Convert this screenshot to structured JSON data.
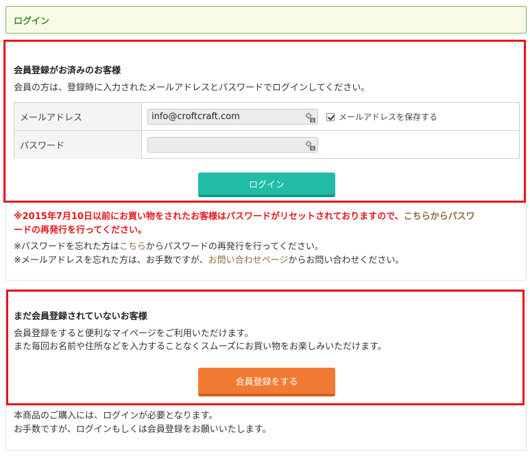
{
  "header": {
    "title": "ログイン"
  },
  "member_section": {
    "title": "会員登録がお済みのお客様",
    "description": "会員の方は、登録時に入力されたメールアドレスとパスワードでログインしてください。",
    "email_label": "メールアドレス",
    "email_value": "info@croftcraft.com",
    "remember_label": "メールアドレスを保存する",
    "password_label": "パスワード",
    "password_value": "",
    "login_button": "ログイン"
  },
  "notice": {
    "warning_pre": "※2015年7月10日以前にお買い物をされたお客様はパスワードがリセットされておりますので、",
    "warning_link": "こちらからパスワ",
    "warning_post": "ードの再発行を行ってください。",
    "forgot_pw_pre": "※パスワードを忘れた方は",
    "forgot_pw_link": "こちら",
    "forgot_pw_post": "からパスワードの再発行を行ってください。",
    "forgot_mail_pre": "※メールアドレスを忘れた方は、お手数ですが、",
    "forgot_mail_link": "お問い合わせページ",
    "forgot_mail_post": "からお問い合わせください。"
  },
  "guest_section": {
    "title": "まだ会員登録されていないお客様",
    "line1": "会員登録をすると便利なマイページをご利用いただけます。",
    "line2": "また毎回お名前や住所などを入力することなくスムーズにお買い物をお楽しみいただけます。",
    "register_button": "会員登録をする",
    "footer1": "本商品のご購入には、ログインが必要となります。",
    "footer2": "お手数ですが、ログインもしくは会員登録をお願いいたします。"
  },
  "colors": {
    "login_button": "#21bca5",
    "register_button": "#f27b33",
    "highlight_box": "#e8161b",
    "header_text": "#3a8a2f"
  }
}
